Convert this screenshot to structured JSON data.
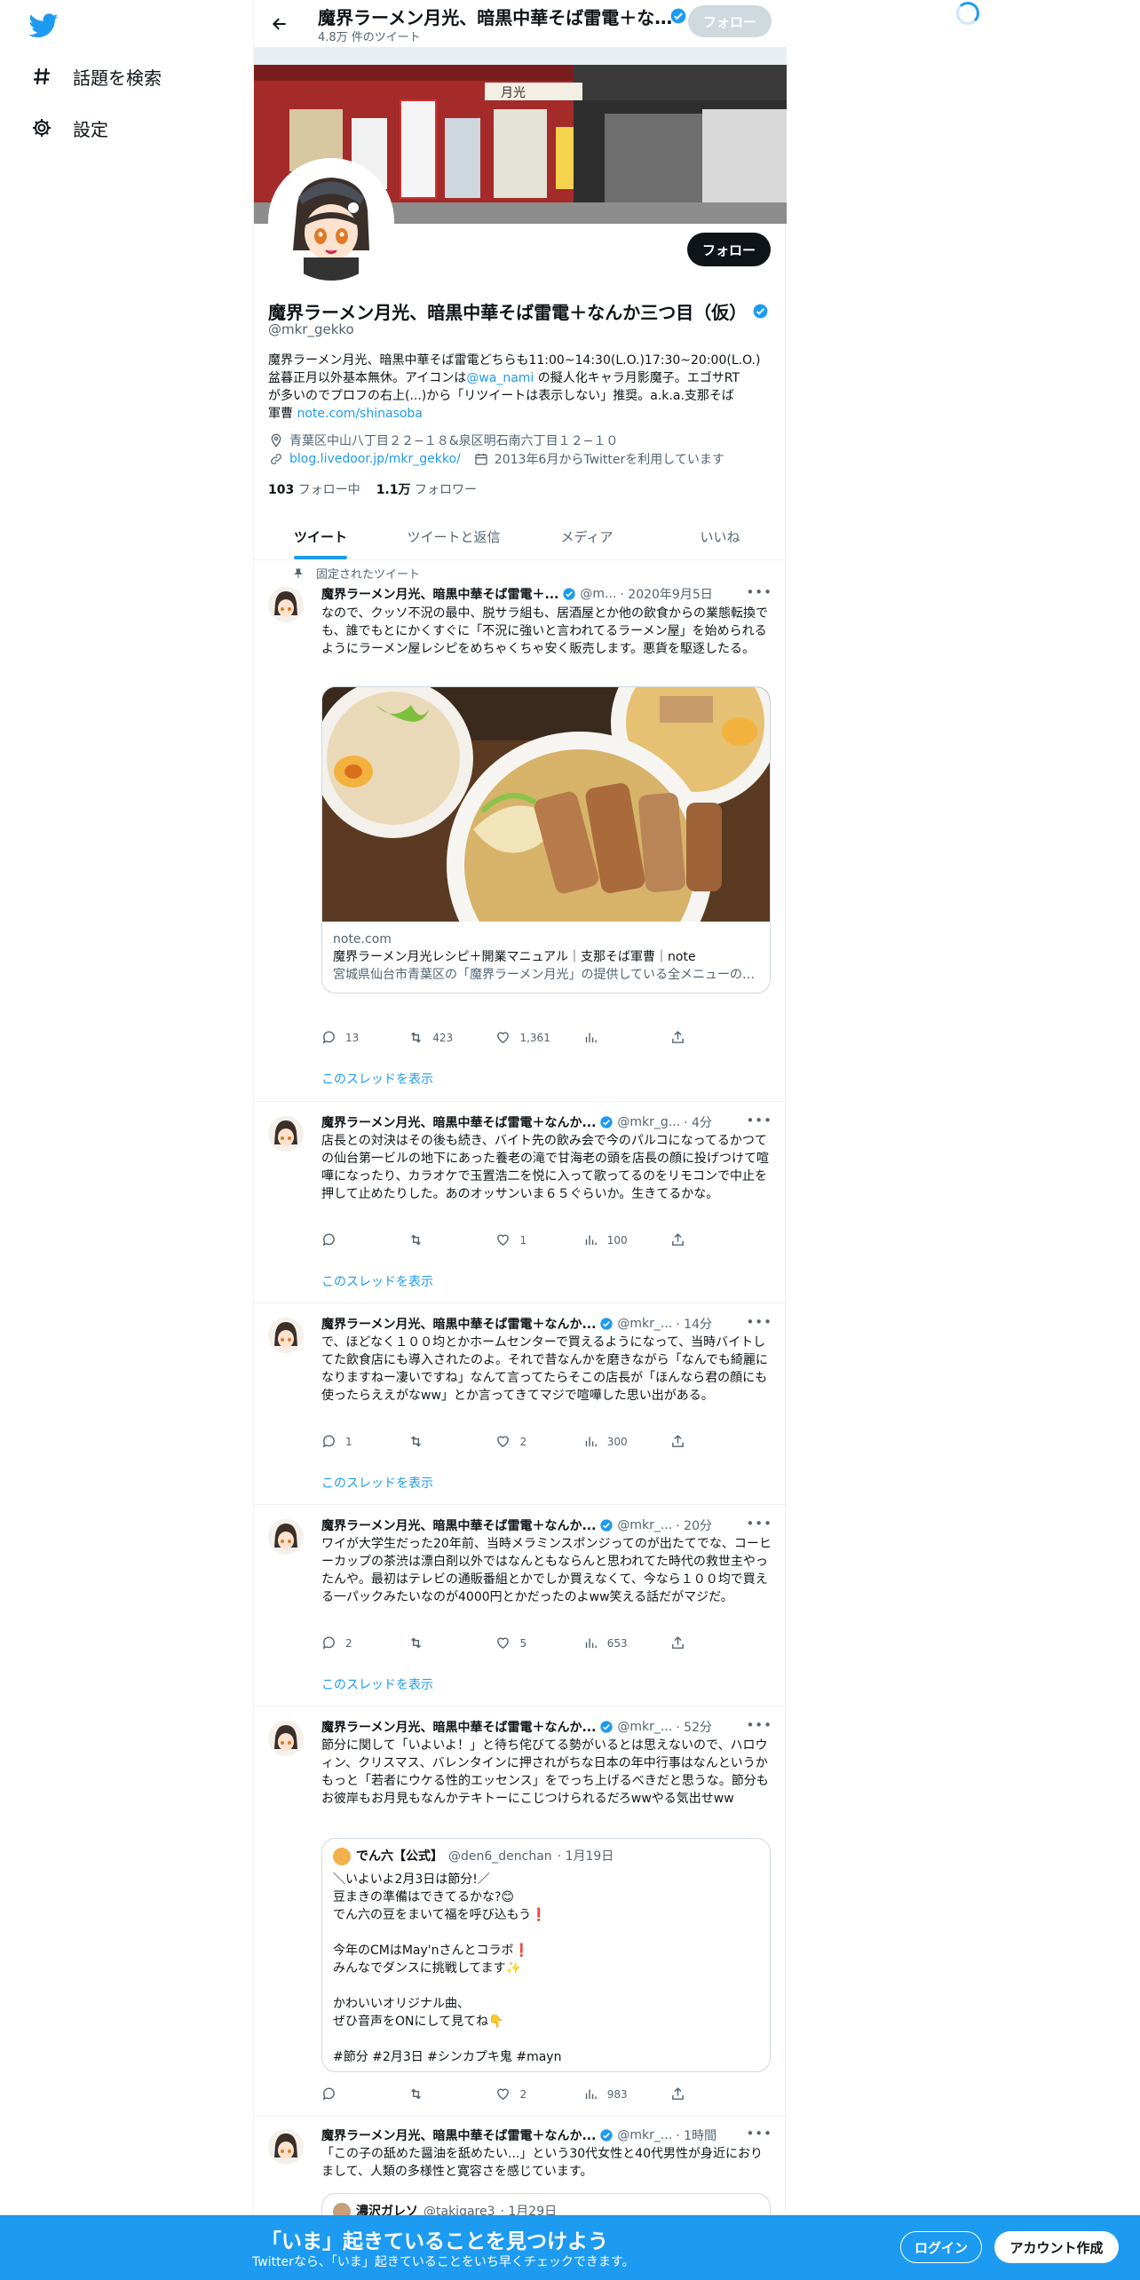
{
  "nav": {
    "explore_label": "話題を検索",
    "settings_label": "設定"
  },
  "header": {
    "title": "魔界ラーメン月光、暗黒中華そば雷電＋なんか三つ目（仮）",
    "tweet_count": "4.8万 件のツイート",
    "follow_label": "フォロー"
  },
  "profile": {
    "name": "魔界ラーメン月光、暗黒中華そば雷電＋なんか三つ目（仮）",
    "handle": "@mkr_gekko",
    "follow_label": "フォロー",
    "bio_line1": "魔界ラーメン月光、暗黒中華そば雷電どちらも11:00~14:30(L.O.)17:30~20:00(L.O.)",
    "bio_line2a": "盆暮正月以外基本無休。アイコンは",
    "bio_mention": "@wa_nami",
    "bio_line2b": " の擬人化キャラ月影魔子。エゴサRT",
    "bio_line3": "が多いのでプロフの右上(...)から「リツイートは表示しない」推奨。a.k.a.支那そば",
    "bio_line4": "軍曹 ",
    "bio_link": "note.com/shinasoba",
    "location": "青葉区中山八丁目２２−１８&泉区明石南六丁目１２−１０",
    "website": "blog.livedoor.jp/mkr_gekko/",
    "joined": "2013年6月からTwitterを利用しています",
    "following_count": "103",
    "following_label": "フォロー中",
    "followers_count": "1.1万",
    "followers_label": "フォロワー"
  },
  "tabs": [
    "ツイート",
    "ツイートと返信",
    "メディア",
    "いいね"
  ],
  "pinned_label": "固定されたツイート",
  "show_thread": "このスレッドを表示",
  "tweets": [
    {
      "name": "魔界ラーメン月光、暗黒中華そば雷電＋...",
      "handle": "@m...",
      "time": "· 2020年9月5日",
      "text": "なので、クッソ不況の最中、脱サラ組も、居酒屋とか他の飲食からの業態転換でも、誰でもとにかくすぐに「不況に強いと言われてるラーメン屋」を始められるようにラーメン屋レシピをめちゃくちゃ安く販売します。悪貨を駆逐したる。",
      "card_domain": "note.com",
      "card_title": "魔界ラーメン月光レシピ＋開業マニュアル｜支那そば軍曹｜note",
      "card_desc": "宮城県仙台市青葉区の「魔界ラーメン月光」の提供している全メニューのレシピです。福岡県某店で採用されて実際に開業した実績がありま...",
      "replies": "13",
      "retweets": "423",
      "likes": "1,361",
      "views": ""
    },
    {
      "name": "魔界ラーメン月光、暗黒中華そば雷電＋なんか...",
      "handle": "@mkr_g...",
      "time": "· 4分",
      "text": "店長との対決はその後も続き、バイト先の飲み会で今のパルコになってるかつての仙台第一ビルの地下にあった養老の滝で甘海老の頭を店長の顔に投げつけて喧嘩になったり、カラオケで玉置浩二を悦に入って歌ってるのをリモコンで中止を押して止めたりした。あのオッサンいま６５ぐらいか。生きてるかな。",
      "replies": "",
      "retweets": "",
      "likes": "1",
      "views": "100"
    },
    {
      "name": "魔界ラーメン月光、暗黒中華そば雷電＋なんか...",
      "handle": "@mkr_...",
      "time": "· 14分",
      "text": "で、ほどなく１００均とかホームセンターで買えるようになって、当時バイトしてた飲食店にも導入されたのよ。それで昔なんかを磨きながら「なんでも綺麗になりますねー凄いですね」なんて言ってたらそこの店長が「ほんなら君の顔にも使ったらええがなww」とか言ってきてマジで喧嘩した思い出がある。",
      "replies": "1",
      "retweets": "",
      "likes": "2",
      "views": "300"
    },
    {
      "name": "魔界ラーメン月光、暗黒中華そば雷電＋なんか...",
      "handle": "@mkr_...",
      "time": "· 20分",
      "text": "ワイが大学生だった20年前、当時メラミンスポンジってのが出たてでな、コーヒーカップの茶渋は漂白剤以外ではなんともならんと思われてた時代の救世主やったんや。最初はテレビの通販番組とかでしか買えなくて、今なら１００均で買える一パックみたいなのが4000円とかだったのよww笑える話だがマジだ。",
      "replies": "2",
      "retweets": "",
      "likes": "5",
      "views": "653"
    },
    {
      "name": "魔界ラーメン月光、暗黒中華そば雷電＋なんか...",
      "handle": "@mkr_...",
      "time": "· 52分",
      "text": "節分に関して「いよいよ！」と待ち侘びてる勢がいるとは思えないので、ハロウィン、クリスマス、バレンタインに押されがちな日本の年中行事はなんというかもっと「若者にウケる性的エッセンス」をでっち上げるべきだと思うな。節分もお彼岸もお月見もなんかテキトーにこじつけられるだろwwやる気出せww",
      "quote_name": "でん六【公式】",
      "quote_handle": "@den6_denchan",
      "quote_time": "· 1月19日",
      "quote_lines": [
        "＼いよいよ2月3日は節分!／",
        "豆まきの準備はできてるかな?😊",
        "でん六の豆をまいて福を呼び込もう❗",
        "",
        "今年のCMはMay'nさんとコラボ❗",
        "みんなでダンスに挑戦してます✨",
        "",
        "かわいいオリジナル曲、",
        "ぜひ音声をONにして見てね👇",
        "",
        "#節分 #2月3日 #シンカプキ鬼 #mayn"
      ],
      "replies": "",
      "retweets": "",
      "likes": "2",
      "views": "983"
    },
    {
      "name": "魔界ラーメン月光、暗黒中華そば雷電＋なんか...",
      "handle": "@mkr_...",
      "time": "· 1時間",
      "text": "「この子の舐めた醤油を舐めたい...」という30代女性と40代男性が身近におりまして、人類の多様性と寛容さを感じています。",
      "quote_name": "濃沢ガレソ",
      "quote_handle": "@takigare3",
      "quote_time": "· 1月29日"
    }
  ],
  "bottom": {
    "headline": "「いま」起きていることを見つけよう",
    "subline": "Twitterなら、「いま」起きていることをいち早くチェックできます。",
    "login_label": "ログイン",
    "signup_label": "アカウント作成"
  },
  "colors": {
    "accent": "#1d9bf0",
    "text": "#0f1419",
    "muted": "#536471",
    "border": "#eff3f4"
  }
}
